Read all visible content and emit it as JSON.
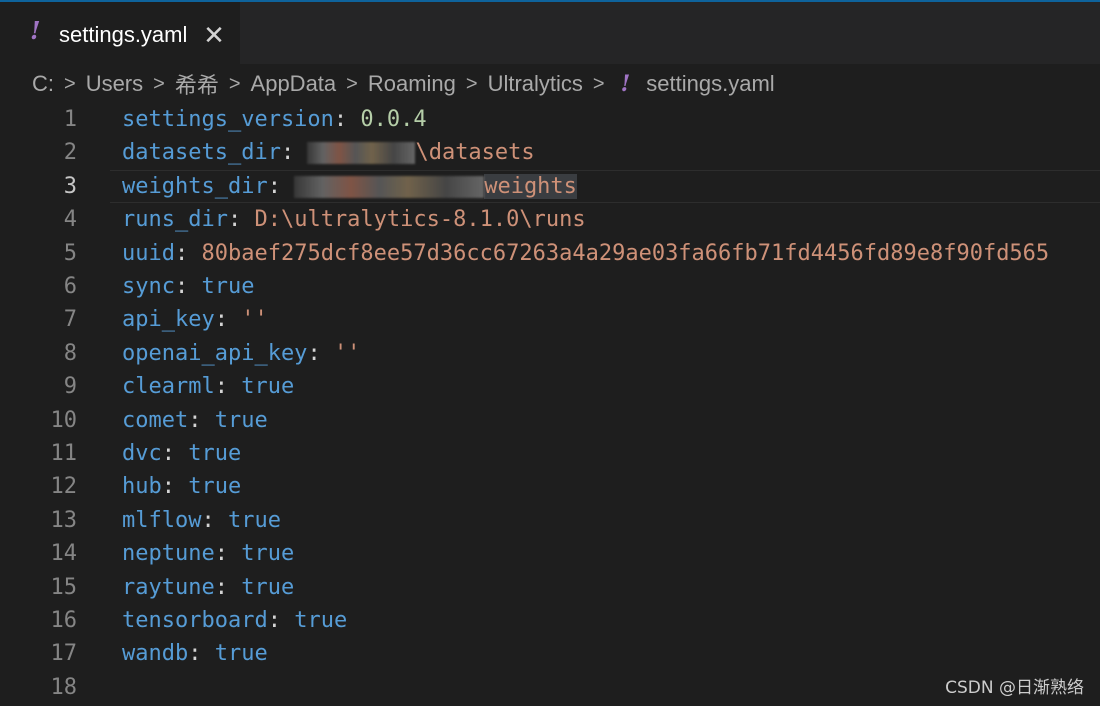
{
  "tab": {
    "icon": "yaml-exclamation-icon",
    "label": "settings.yaml",
    "close": "✕"
  },
  "breadcrumb": [
    {
      "label": "C:"
    },
    {
      "label": "Users"
    },
    {
      "label": "希希"
    },
    {
      "label": "AppData"
    },
    {
      "label": "Roaming"
    },
    {
      "label": "Ultralytics"
    }
  ],
  "breadcrumb_file": {
    "icon": "yaml-exclamation-icon",
    "label": "settings.yaml"
  },
  "lines": [
    {
      "n": "1",
      "key": "settings_version",
      "value": "0.0.4",
      "vtype": "num"
    },
    {
      "n": "2",
      "key": "datasets_dir",
      "value": "\\datasets",
      "vtype": "str",
      "redacted": true
    },
    {
      "n": "3",
      "key": "weights_dir",
      "value": "weights",
      "vtype": "str",
      "redacted": true
    },
    {
      "n": "4",
      "key": "runs_dir",
      "value": "D:\\ultralytics-8.1.0\\runs",
      "vtype": "str"
    },
    {
      "n": "5",
      "key": "uuid",
      "value": "80baef275dcf8ee57d36cc67263a4a29ae03fa66fb71fd4456fd89e8f90fd565",
      "vtype": "str"
    },
    {
      "n": "6",
      "key": "sync",
      "value": "true",
      "vtype": "bool"
    },
    {
      "n": "7",
      "key": "api_key",
      "value": "''",
      "vtype": "str"
    },
    {
      "n": "8",
      "key": "openai_api_key",
      "value": "''",
      "vtype": "str"
    },
    {
      "n": "9",
      "key": "clearml",
      "value": "true",
      "vtype": "bool"
    },
    {
      "n": "10",
      "key": "comet",
      "value": "true",
      "vtype": "bool"
    },
    {
      "n": "11",
      "key": "dvc",
      "value": "true",
      "vtype": "bool"
    },
    {
      "n": "12",
      "key": "hub",
      "value": "true",
      "vtype": "bool"
    },
    {
      "n": "13",
      "key": "mlflow",
      "value": "true",
      "vtype": "bool"
    },
    {
      "n": "14",
      "key": "neptune",
      "value": "true",
      "vtype": "bool"
    },
    {
      "n": "15",
      "key": "raytune",
      "value": "true",
      "vtype": "bool"
    },
    {
      "n": "16",
      "key": "tensorboard",
      "value": "true",
      "vtype": "bool"
    },
    {
      "n": "17",
      "key": "wandb",
      "value": "true",
      "vtype": "bool"
    },
    {
      "n": "18",
      "key": "",
      "value": "",
      "vtype": ""
    }
  ],
  "current_line": "3",
  "watermark": "CSDN @日渐熟络",
  "colors": {
    "key": "#569cd6",
    "string": "#ce9178",
    "number": "#b5cea8",
    "yaml_icon": "#a074c4"
  }
}
